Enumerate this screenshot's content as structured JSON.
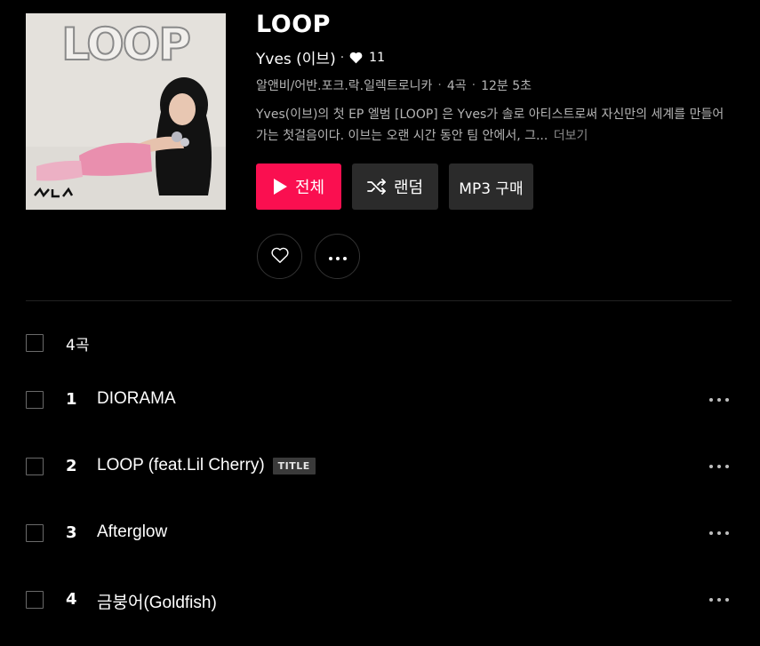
{
  "album": {
    "cover_text": "LOOP",
    "title": "LOOP",
    "artist": "Yves (이브)",
    "separator": "·",
    "likes": "11",
    "genre": "알앤비/어반.포크.락.일렉트로니카",
    "track_count": "4곡",
    "duration": "12분 5초",
    "meta_dot": "·",
    "description": "Yves(이브)의 첫 EP 엘범 [LOOP] 은 Yves가 솔로 아티스트로써 자신만의 세계를 만들어가는 첫걸음이다. 이브는 오랜 시간 동안 팀 안에서, 그...",
    "more_label": "더보기"
  },
  "buttons": {
    "play_all": "전체",
    "shuffle": "랜덤",
    "mp3": "MP3 구매"
  },
  "tracklist": {
    "count_label": "4곡",
    "tracks": [
      {
        "number": "1",
        "title": "DIORAMA",
        "badge": ""
      },
      {
        "number": "2",
        "title": "LOOP (feat.Lil Cherry)",
        "badge": "TITLE"
      },
      {
        "number": "3",
        "title": "Afterglow",
        "badge": ""
      },
      {
        "number": "4",
        "title": "금붕어(Goldfish)",
        "badge": ""
      }
    ]
  },
  "colors": {
    "accent": "#fa0f50",
    "background": "#000000",
    "button_dark": "#2b2b2b",
    "text_muted": "#b5b5b5"
  },
  "icons": {
    "heart_small": "heart-icon",
    "play": "play-icon",
    "shuffle": "shuffle-icon",
    "like_outline": "heart-outline-icon",
    "more": "more-dots-icon"
  }
}
